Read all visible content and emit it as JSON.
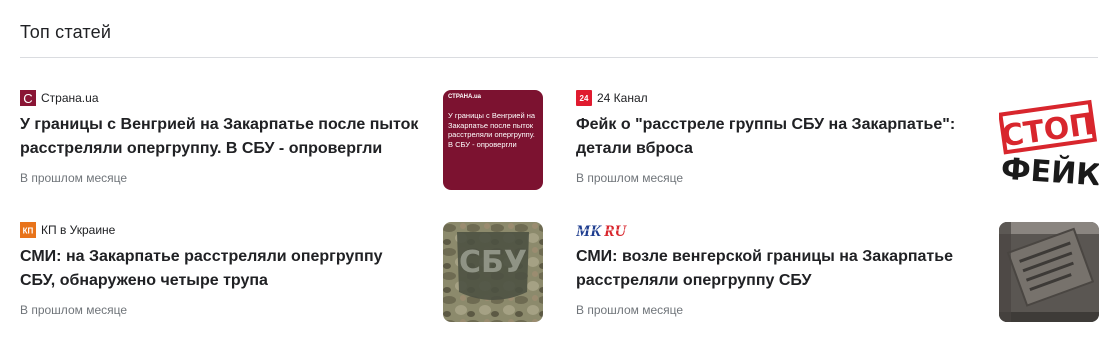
{
  "section": {
    "title": "Топ статей"
  },
  "articles": [
    {
      "source": "Страна.ua",
      "favicon_icon": "strana-ua-logo-icon",
      "favicon_glyph": "C",
      "favicon_color": "#8a1535",
      "headline": "У границы с Венгрией на Закарпатье после пыток расстреляли опергруппу. В СБУ - опровергли",
      "time": "В прошлом месяце",
      "thumb": {
        "bg": "#7c1230",
        "brand": "СТРАНА.ua",
        "text": "У границы с Венгрией на Закарпатье после пыток расстреляли опергруппу. В СБУ - опровергли"
      }
    },
    {
      "source": "24 Канал",
      "favicon_icon": "24-kanal-logo-icon",
      "favicon_glyph": "24",
      "favicon_color": "#e01b2f",
      "headline": "Фейк о \"расстреле группы СБУ на Закарпатье\": детали вброса",
      "time": "В прошлом месяце",
      "thumb": {
        "stamp_top": "СТОП",
        "stamp_bottom": "ФЕЙК"
      }
    },
    {
      "source": "КП в Украине",
      "favicon_icon": "kp-logo-icon",
      "favicon_glyph": "КП",
      "favicon_color": "#e8731a",
      "headline": "СМИ: на Закарпатье расстреляли опергруппу СБУ, обнаружено четыре трупа",
      "time": "В прошлом месяце",
      "thumb": {
        "patch_text": "СБУ"
      }
    },
    {
      "source": "MK.RU",
      "favicon_icon": "mk-ru-logo-icon",
      "headline": "СМИ: возле венгерской границы на Закарпатье расстреляли опергруппу СБУ",
      "time": "В прошлом месяце",
      "thumb": {}
    }
  ]
}
